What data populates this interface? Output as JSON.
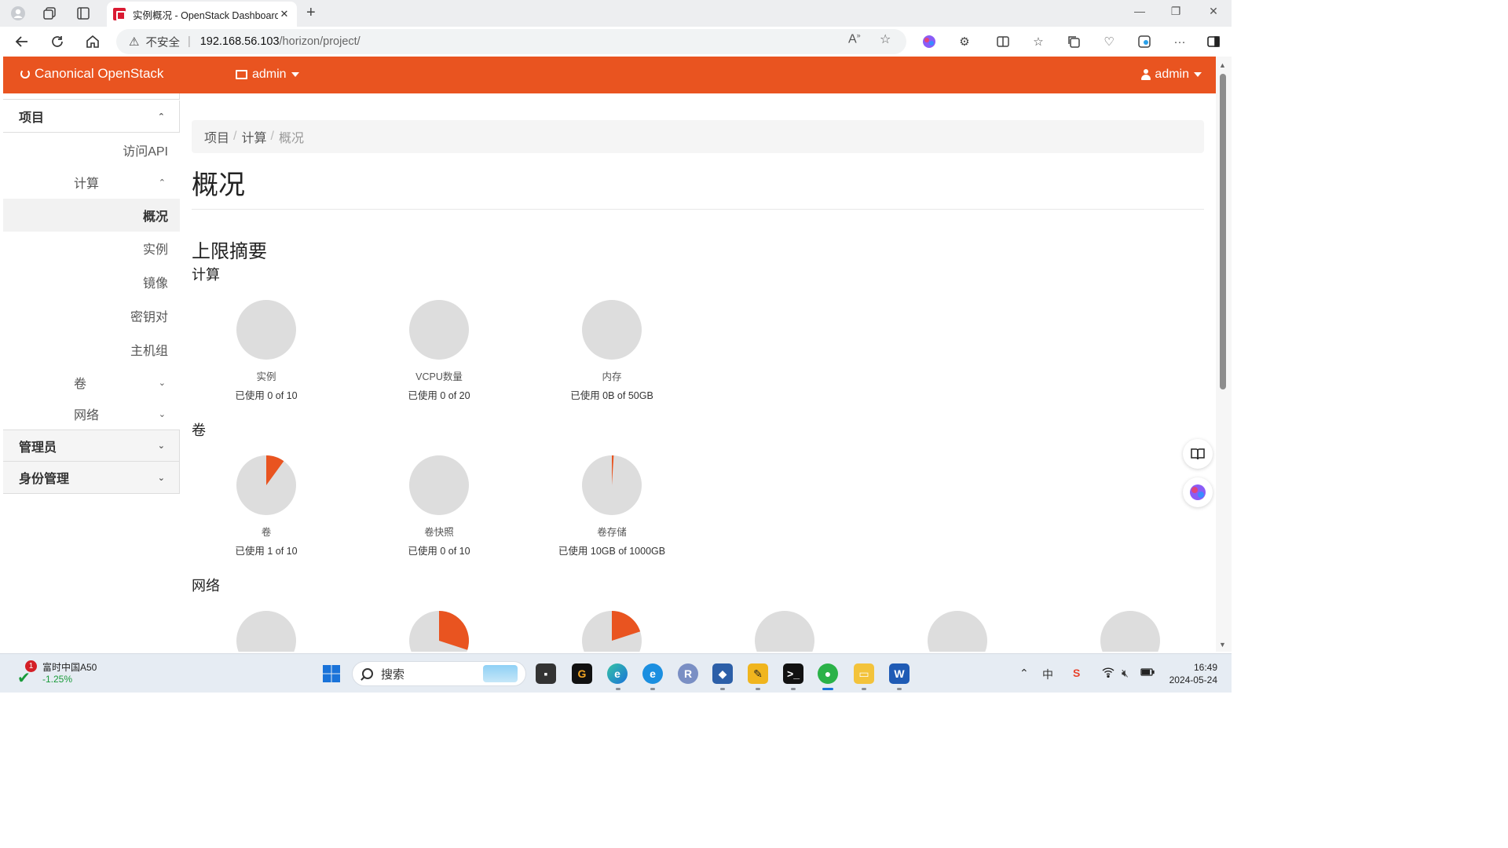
{
  "browser": {
    "tab_title": "实例概况 - OpenStack Dashboard",
    "tab_close": "✕",
    "new_tab": "+",
    "url_warning": "不安全",
    "url_host": "192.168.56.103",
    "url_path": "/horizon/project/"
  },
  "topnav": {
    "brand": "Canonical OpenStack",
    "project": "admin",
    "user": "admin",
    "color": "#e95420"
  },
  "sidebar": {
    "project": "项目",
    "access_api": "访问API",
    "compute": "计算",
    "overview": "概况",
    "instances": "实例",
    "images": "镜像",
    "keypairs": "密钥对",
    "server_groups": "主机组",
    "volumes": "卷",
    "network": "网络",
    "admin": "管理员",
    "identity": "身份管理"
  },
  "breadcrumb": [
    "项目",
    "计算",
    "概况"
  ],
  "page_title": "概况",
  "limit_summary": "上限摘要",
  "sections": {
    "compute": "计算",
    "volume": "卷",
    "network": "网络"
  },
  "compute_pies": [
    {
      "name": "实例",
      "usage": "已使用 0 of 10",
      "used": 0,
      "total": 10
    },
    {
      "name": "VCPU数量",
      "usage": "已使用 0 of 20",
      "used": 0,
      "total": 20
    },
    {
      "name": "内存",
      "usage": "已使用 0B of 50GB",
      "used": 0,
      "total": 50
    }
  ],
  "volume_pies": [
    {
      "name": "卷",
      "usage": "已使用 1 of 10",
      "used": 1,
      "total": 10
    },
    {
      "name": "卷快照",
      "usage": "已使用 0 of 10",
      "used": 0,
      "total": 10
    },
    {
      "name": "卷存储",
      "usage": "已使用 10GB of 1000GB",
      "used": 10,
      "total": 1000
    }
  ],
  "network_pies_fraction": [
    0,
    0.3,
    0.2,
    0,
    0,
    0
  ],
  "pie_colors": {
    "used": "#e95420",
    "free": "#dddddd"
  },
  "taskbar": {
    "stock_name": "富时中国A50",
    "stock_change": "-1.25%",
    "stock_badge": "1",
    "search": "搜索",
    "time": "16:49",
    "date": "2024-05-24",
    "ime": "中"
  }
}
